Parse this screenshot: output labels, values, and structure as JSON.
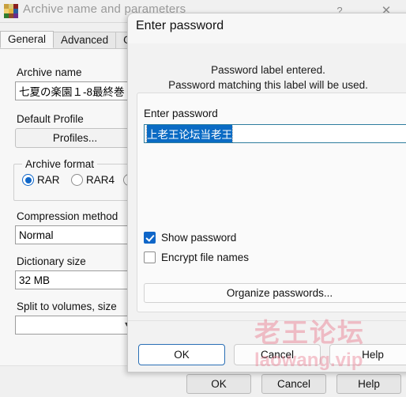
{
  "main_window": {
    "title": "Archive name and parameters",
    "icon": "winrar-books-icon",
    "titlebar_buttons": {
      "help": "?",
      "close": "✕"
    },
    "tabs": [
      {
        "label": "General",
        "active": true
      },
      {
        "label": "Advanced",
        "active": false
      },
      {
        "label": "Optio",
        "active": false
      }
    ],
    "fields": {
      "archive_name_label": "Archive name",
      "archive_name_value": "七夏の楽園１-8最終巻",
      "default_profile_label": "Default Profile",
      "profiles_button": "Profiles...",
      "archive_format_label": "Archive format",
      "format_options": [
        {
          "label": "RAR",
          "selected": true
        },
        {
          "label": "RAR4",
          "selected": false
        },
        {
          "label": "",
          "selected": false
        }
      ],
      "compression_method_label": "Compression method",
      "compression_method_value": "Normal",
      "dictionary_size_label": "Dictionary size",
      "dictionary_size_value": "32 MB",
      "split_volumes_label": "Split to volumes, size",
      "split_volumes_value": ""
    },
    "footer": {
      "ok": "OK",
      "cancel": "Cancel",
      "help": "Help"
    }
  },
  "password_dialog": {
    "title": "Enter password",
    "note_line1": "Password label entered.",
    "note_line2": "Password matching this label will be used.",
    "field_label": "Enter password",
    "password_value": "上老王论坛当老王",
    "show_password": {
      "label": "Show password",
      "checked": true
    },
    "encrypt_file_names": {
      "label": "Encrypt file names",
      "checked": false
    },
    "organize_button": "Organize passwords...",
    "buttons": {
      "ok": "OK",
      "cancel": "Cancel",
      "help": "Help"
    },
    "colors": {
      "accent": "#0f66c8",
      "selection": "#0a6bc4",
      "input_border": "#2e7d9e",
      "default_button_border": "#2a6fb5"
    }
  },
  "watermark": {
    "line1": "老王论坛",
    "line2": "laowang.vip",
    "color": "#e9788c"
  }
}
